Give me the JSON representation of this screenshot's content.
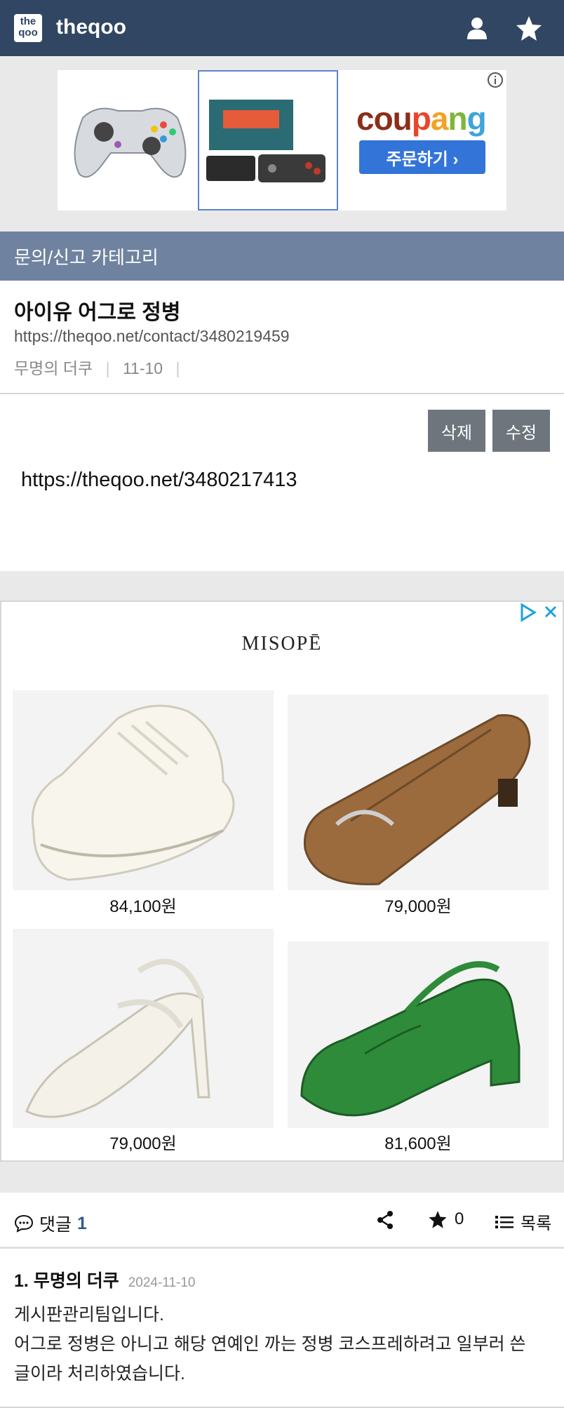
{
  "header": {
    "logo_text": "the qoo",
    "brand": "theqoo",
    "icons": [
      "user-icon",
      "star-icon"
    ]
  },
  "top_ad": {
    "logo_text": "coupang",
    "cta": "주문하기 ›",
    "colors": {
      "button": "#3374d9"
    }
  },
  "category": {
    "label": "문의/신고 카테고리"
  },
  "post": {
    "title": "아이유 어그로 정병",
    "url": "https://theqoo.net/contact/3480219459",
    "author": "무명의 더쿠",
    "date": "11-10",
    "delete_label": "삭제",
    "edit_label": "수정",
    "body": "https://theqoo.net/3480217413"
  },
  "shoe_ad": {
    "brand": "MISOPĒ",
    "items": [
      {
        "name": "white-sneaker",
        "price": "84,100원"
      },
      {
        "name": "brown-loafer",
        "price": "79,000원"
      },
      {
        "name": "white-slingback-heel",
        "price": "79,000원"
      },
      {
        "name": "green-slingback-flat",
        "price": "81,600원"
      }
    ]
  },
  "comments_bar": {
    "label": "댓글",
    "count": "1",
    "star_count": "0",
    "list_label": "목록"
  },
  "comment": {
    "index": "1.",
    "author": "무명의 더쿠",
    "date": "2024-11-10",
    "lines": [
      "게시판관리팀입니다.",
      "어그로 정병은 아니고 해당 연예인 까는 정병 코스프레하려고 일부러 쓴",
      "글이라 처리하였습니다."
    ]
  },
  "colors": {
    "header_bg": "#304663",
    "category_bg": "#6f83a0",
    "button_gray": "#6e757c",
    "accent": "#2f5a96"
  }
}
